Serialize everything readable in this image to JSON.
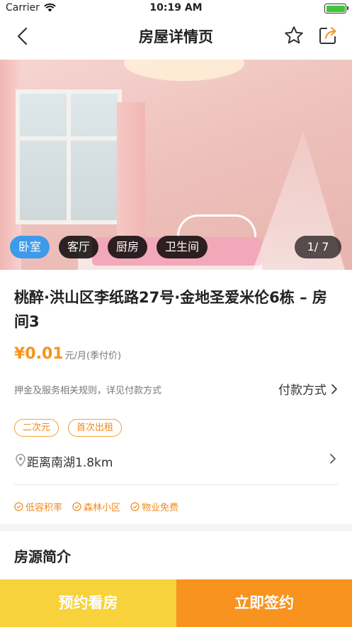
{
  "status_bar": {
    "carrier": "Carrier",
    "time": "10:19 AM"
  },
  "nav": {
    "title": "房屋详情页"
  },
  "gallery": {
    "tabs": [
      {
        "label": "卧室",
        "active": true
      },
      {
        "label": "客厅",
        "active": false
      },
      {
        "label": "厨房",
        "active": false
      },
      {
        "label": "卫生间",
        "active": false
      }
    ],
    "counter": "1/ 7"
  },
  "listing": {
    "title": "桃醉·洪山区李纸路27号·金地圣爱米伦6栋 – 房间3",
    "price": "¥0.01",
    "price_unit": "元/月(季付价)",
    "rule_text": "押金及服务相关规则，详见付款方式",
    "pay_link": "付款方式",
    "tags": [
      "二次元",
      "首次出租"
    ],
    "location": "距离南湖1.8km",
    "features": [
      "低容积率",
      "森林小区",
      "物业免费"
    ]
  },
  "section": {
    "intro_title": "房源简介"
  },
  "actions": {
    "appoint": "预约看房",
    "sign": "立即签约"
  },
  "colors": {
    "accent": "#f7931e",
    "yellow": "#f7d23a",
    "tab_active": "#3d9be9"
  }
}
